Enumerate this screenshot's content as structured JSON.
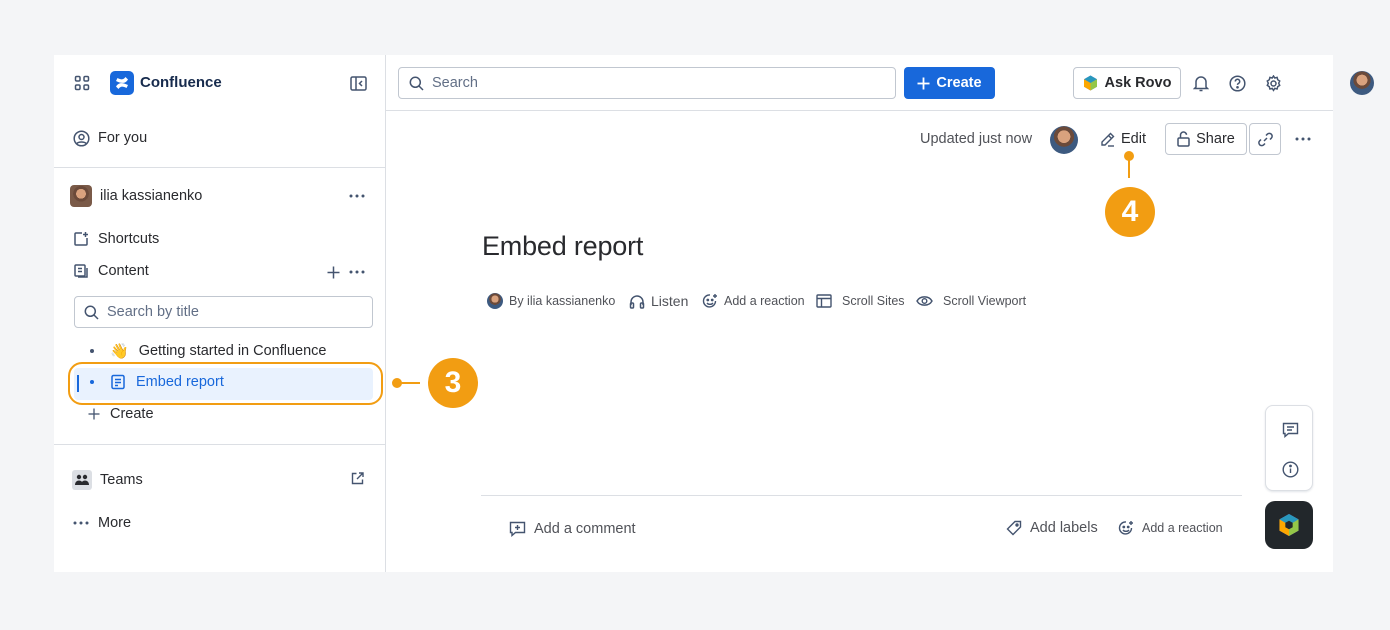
{
  "app": {
    "brand": "Confluence"
  },
  "sidebar": {
    "for_you": "For you",
    "user_name": "ilia kassianenko",
    "shortcuts": "Shortcuts",
    "content": "Content",
    "search_placeholder": "Search by title",
    "tree": [
      {
        "emoji": "👋",
        "label": "Getting started in Confluence"
      },
      {
        "label": "Embed report",
        "selected": true
      }
    ],
    "create": "Create",
    "teams": "Teams",
    "more": "More"
  },
  "topbar": {
    "search_placeholder": "Search",
    "create_label": "Create",
    "ask_rovo": "Ask Rovo"
  },
  "page": {
    "updated": "Updated just now",
    "edit": "Edit",
    "share": "Share",
    "title": "Embed report",
    "byline": {
      "author": "By ilia kassianenko",
      "listen": "Listen",
      "add_reaction": "Add a reaction",
      "scroll_sites": "Scroll Sites",
      "scroll_viewport": "Scroll Viewport"
    },
    "footer": {
      "add_comment": "Add a comment",
      "add_labels": "Add labels",
      "add_reaction": "Add a reaction"
    }
  },
  "callouts": {
    "step3": "3",
    "step4": "4"
  },
  "colors": {
    "brand_blue": "#1868db",
    "callout_orange": "#f29d12",
    "selected_bg": "#e9f2fe"
  }
}
